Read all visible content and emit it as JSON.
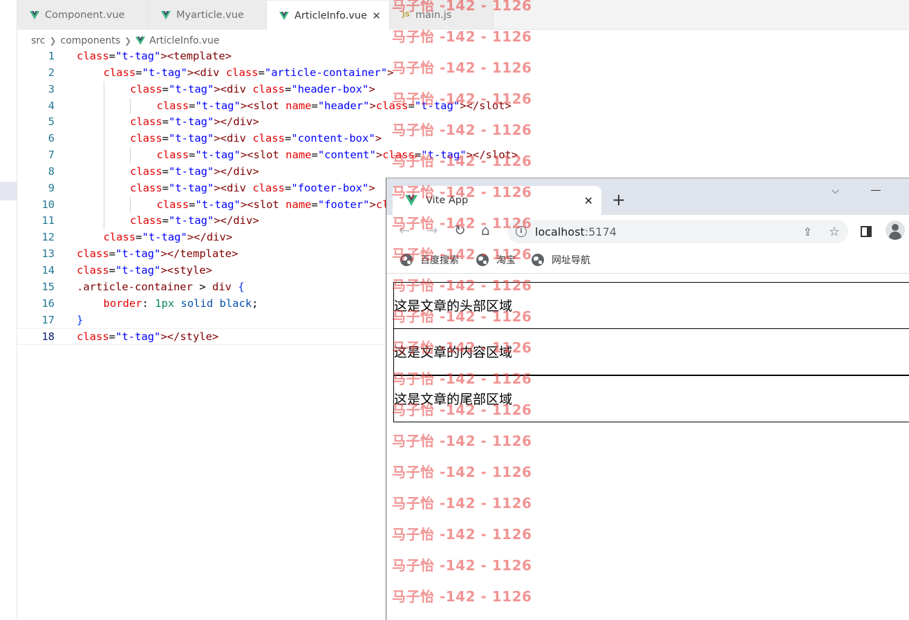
{
  "editor": {
    "tabs": [
      {
        "label": "Component.vue",
        "type": "vue",
        "active": false
      },
      {
        "label": "Myarticle.vue",
        "type": "vue",
        "active": false
      },
      {
        "label": "ArticleInfo.vue",
        "type": "vue",
        "active": true
      },
      {
        "label": "main.js",
        "type": "js",
        "active": false
      }
    ],
    "js_badge": "JS",
    "close_glyph": "✕",
    "breadcrumb": {
      "folder1": "src",
      "folder2": "components",
      "file": "ArticleInfo.vue"
    },
    "current_line": 18,
    "lines": [
      {
        "n": "1",
        "text": "<template>"
      },
      {
        "n": "2",
        "text": "<div class=\"article-container\">"
      },
      {
        "n": "3",
        "text": "<div class=\"header-box\">"
      },
      {
        "n": "4",
        "text": "<slot name=\"header\"></slot>"
      },
      {
        "n": "5",
        "text": "</div>"
      },
      {
        "n": "6",
        "text": "<div class=\"content-box\">"
      },
      {
        "n": "7",
        "text": "<slot name=\"content\"></slot>"
      },
      {
        "n": "8",
        "text": "</div>"
      },
      {
        "n": "9",
        "text": "<div class=\"footer-box\">"
      },
      {
        "n": "10",
        "text": "<slot name=\"footer\"></slot>"
      },
      {
        "n": "11",
        "text": "</div>"
      },
      {
        "n": "12",
        "text": "</div>"
      },
      {
        "n": "13",
        "text": "</template>"
      },
      {
        "n": "14",
        "text": "<style>"
      },
      {
        "n": "15",
        "text": ".article-container > div {"
      },
      {
        "n": "16",
        "text": "border: 1px solid black;"
      },
      {
        "n": "17",
        "text": "}"
      },
      {
        "n": "18",
        "text": "</style>"
      }
    ]
  },
  "browser": {
    "tab_title": "Vite App",
    "tab_close": "✕",
    "new_tab": "+",
    "chevron": "⌵",
    "url_host": "localhost",
    "url_port": ":5174",
    "info_glyph": "i",
    "back_glyph": "←",
    "forward_glyph": "→",
    "reload_glyph": "↻",
    "home_glyph": "⌂",
    "share_glyph": "⇪",
    "star_glyph": "☆",
    "bookmarks": [
      "百度搜索",
      "淘宝",
      "网址导航"
    ],
    "content": {
      "header": "这是文章的头部区域",
      "content": "这是文章的内容区域",
      "footer": "这是文章的尾部区域"
    }
  },
  "watermark": {
    "text": "马子怡 -142 - 1126"
  }
}
